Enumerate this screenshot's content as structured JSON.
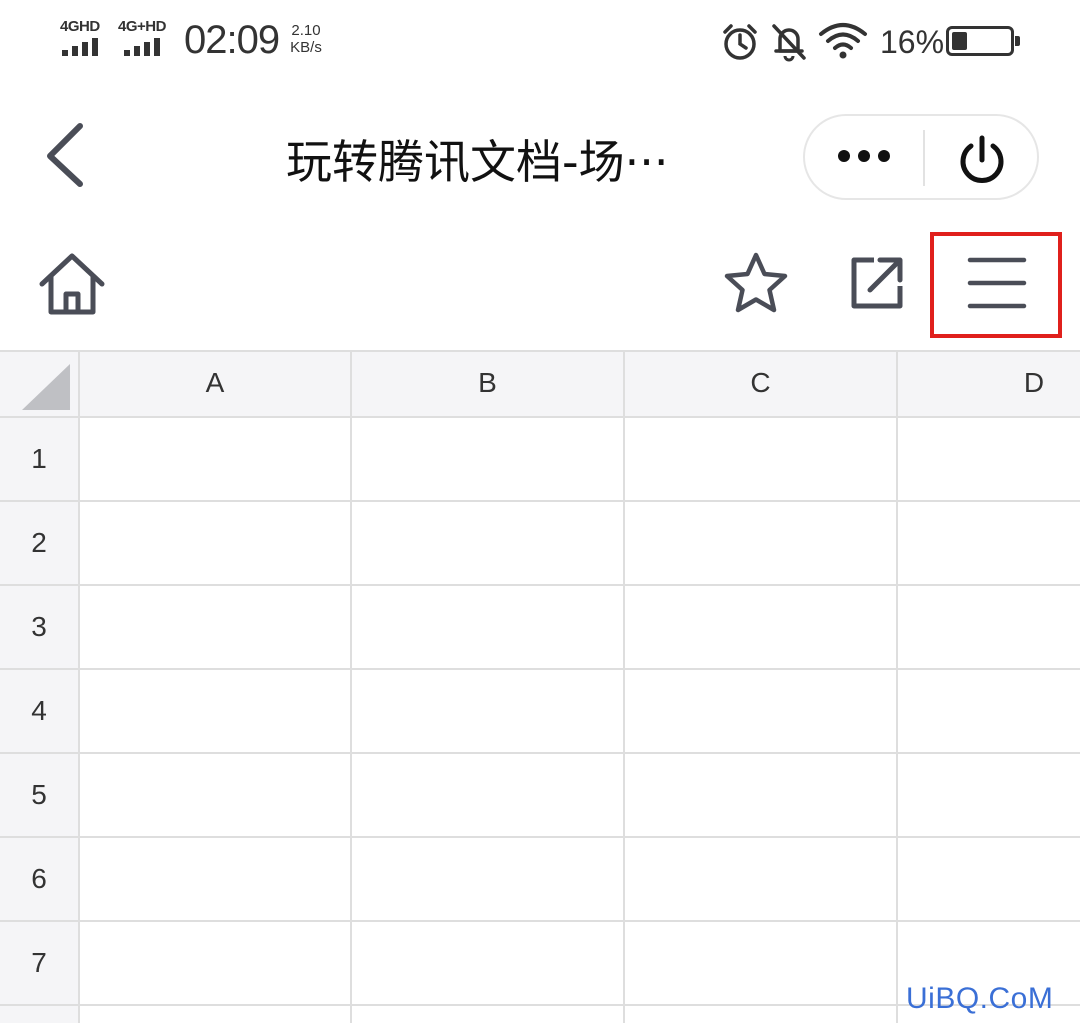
{
  "status_bar": {
    "network_1": "4GHD",
    "network_2": "4G+HD",
    "time": "02:09",
    "speed_value": "2.10",
    "speed_unit": "KB/s",
    "battery_percent": "16%",
    "battery_level": 0.16
  },
  "title_bar": {
    "title": "玩转腾讯文档-场···",
    "more_glyph": "•••"
  },
  "sheet": {
    "columns": [
      "A",
      "B",
      "C",
      "D"
    ],
    "rows": [
      "1",
      "2",
      "3",
      "4",
      "5",
      "6",
      "7"
    ]
  },
  "watermark": "UiBQ.CoM",
  "colors": {
    "highlight": "#e0201c",
    "icon": "#4a4d57",
    "grid_line": "#dedede",
    "header_bg": "#f5f5f7"
  }
}
